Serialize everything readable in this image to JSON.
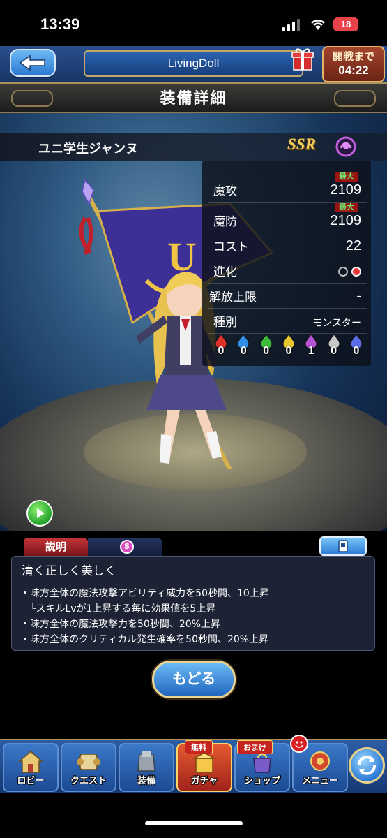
{
  "status_bar": {
    "time": "13:39",
    "battery": "18"
  },
  "header": {
    "title": "LivingDoll",
    "event_label": "開戦まで",
    "event_time": "04:22"
  },
  "page_title": "装備詳細",
  "character": {
    "name": "ユニ学生ジャンヌ",
    "rarity": "SSR"
  },
  "stats": {
    "max_label": "最大",
    "magic_attack": {
      "label": "魔攻",
      "value": "2109"
    },
    "magic_defense": {
      "label": "魔防",
      "value": "2109"
    },
    "cost": {
      "label": "コスト",
      "value": "22"
    },
    "evolution": {
      "label": "進化",
      "filled": 1,
      "total": 2
    },
    "limit_break": {
      "label": "解放上限",
      "value": "-"
    },
    "type": {
      "label": "種別",
      "value": "モンスター"
    },
    "elements": [
      {
        "icon": "fire-icon",
        "color": "#e0312d",
        "count": "0"
      },
      {
        "icon": "water-icon",
        "color": "#2f8fe8",
        "count": "0"
      },
      {
        "icon": "wind-icon",
        "color": "#3dbb3a",
        "count": "0"
      },
      {
        "icon": "light-icon",
        "color": "#e8c62f",
        "count": "0"
      },
      {
        "icon": "dark-icon",
        "color": "#b452d6",
        "count": "1"
      },
      {
        "icon": "void-icon",
        "color": "#c9c9c9",
        "count": "0"
      },
      {
        "icon": "ice-icon",
        "color": "#5b6ee8",
        "count": "0"
      }
    ]
  },
  "tabs": {
    "description": "説明",
    "skill_icon": "S"
  },
  "skill": {
    "name": "清く正しく美しく",
    "lines": [
      "・味方全体の魔法攻撃アビリティ威力を50秒間、10上昇",
      "　└スキルLvが1上昇する毎に効果値を5上昇",
      "・味方全体の魔法攻撃力を50秒間、20%上昇",
      "・味方全体のクリティカル発生確率を50秒間、20%上昇"
    ]
  },
  "back_button": "もどる",
  "nav": {
    "items": [
      {
        "label": "ロビー",
        "icon": "lobby-icon"
      },
      {
        "label": "クエスト",
        "icon": "quest-icon"
      },
      {
        "label": "装備",
        "icon": "equipment-icon"
      },
      {
        "label": "ガチャ",
        "icon": "gacha-icon",
        "badge": "無料"
      },
      {
        "label": "ショップ",
        "icon": "shop-icon",
        "badge": "おまけ"
      },
      {
        "label": "メニュー",
        "icon": "menu-icon"
      }
    ]
  },
  "colors": {
    "accent_gold": "#e2b665",
    "panel_blue": "#1d4a93",
    "alert_red": "#c6251f"
  }
}
